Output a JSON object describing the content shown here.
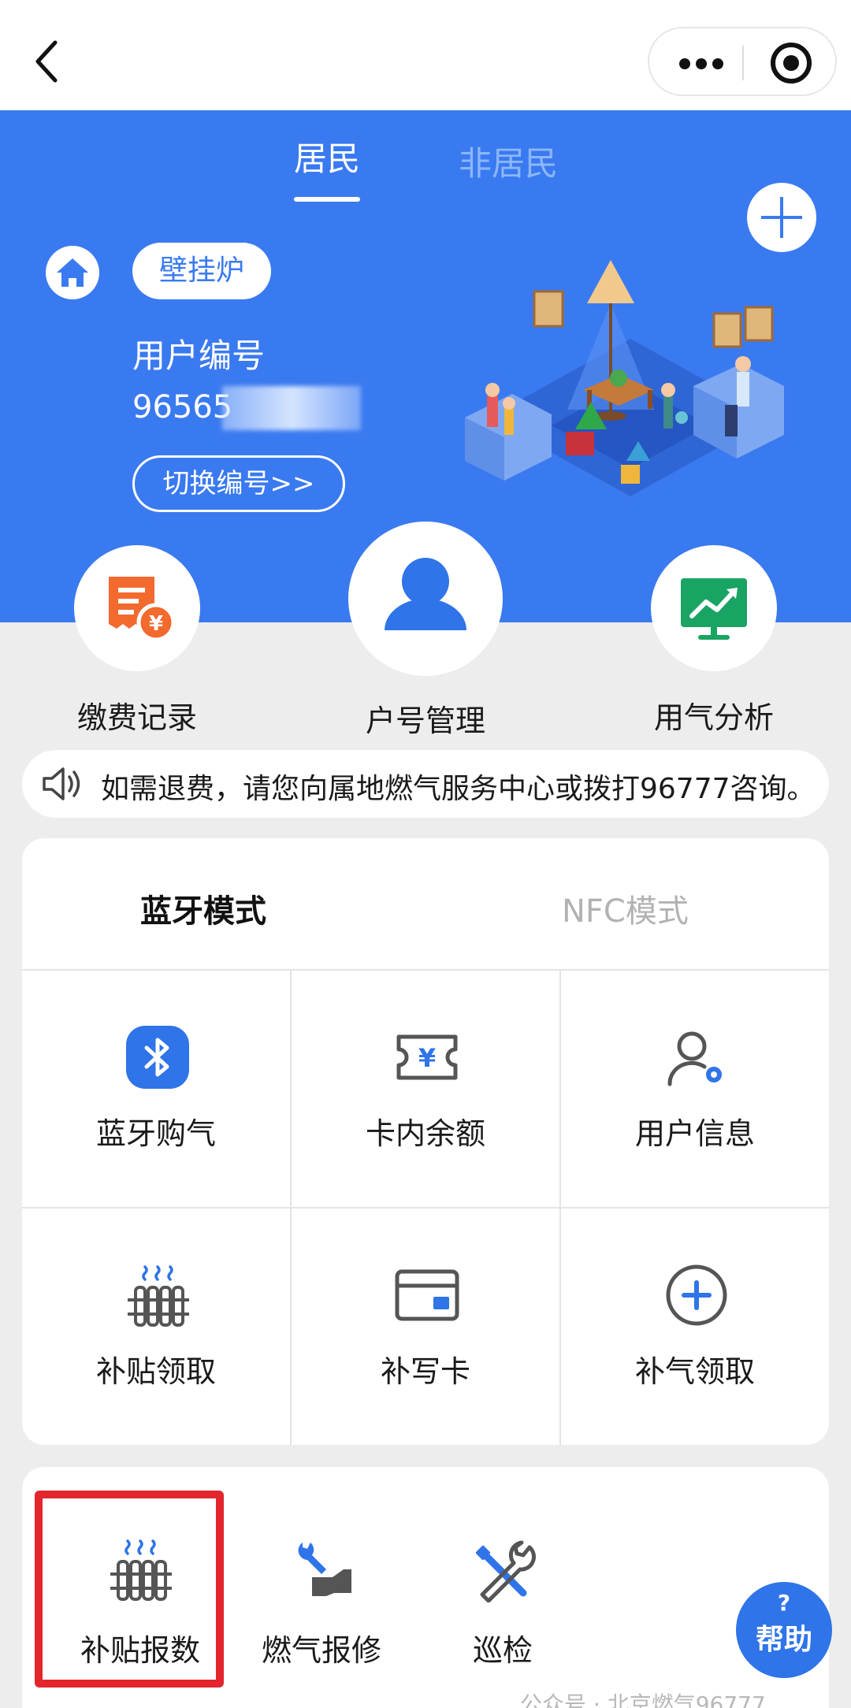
{
  "tabs": {
    "resident": "居民",
    "non_resident": "非居民"
  },
  "account": {
    "type_badge": "壁挂炉",
    "label": "用户编号",
    "number_visible": "96565",
    "switch_button": "切换编号>>"
  },
  "quick_actions": {
    "payment_records": "缴费记录",
    "account_management": "户号管理",
    "usage_analysis": "用气分析"
  },
  "notice": "如需退费，请您向属地燃气服务中心或拨打96777咨询。",
  "modes": {
    "bluetooth": "蓝牙模式",
    "nfc": "NFC模式"
  },
  "grid": {
    "bluetooth_purchase": "蓝牙购气",
    "card_balance": "卡内余额",
    "user_info": "用户信息",
    "subsidy_claim": "补贴领取",
    "rewrite_card": "补写卡",
    "gas_top_up_claim": "补气领取"
  },
  "tools": {
    "subsidy_report": "补贴报数",
    "gas_repair": "燃气报修",
    "inspection": "巡检"
  },
  "help": {
    "mark": "?",
    "label": "帮助"
  },
  "watermark": "公众号 · 北京燃气96777",
  "colors": {
    "brand_blue": "#3a7af0",
    "highlight_red": "#e3262d",
    "payment_orange": "#f26a2e",
    "analysis_green": "#1aa463"
  }
}
